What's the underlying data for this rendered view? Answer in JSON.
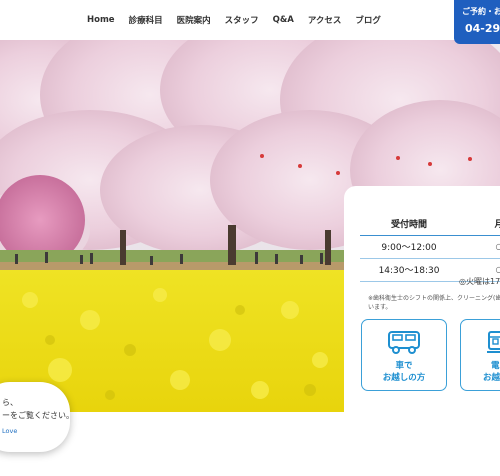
{
  "nav": {
    "items": [
      "Home",
      "診療科目",
      "医院案内",
      "スタッフ",
      "Q&A",
      "アクセス",
      "ブログ"
    ]
  },
  "reserve": {
    "label": "ご予約・お",
    "phone": "04-29",
    "icon": "phone-icon"
  },
  "hours": {
    "header_time": "受付時間",
    "header_day": "月",
    "rows": [
      {
        "time": "9:00〜12:00",
        "mark": "○"
      },
      {
        "time": "14:30〜18:30",
        "mark": "○"
      }
    ],
    "closed": "◎火曜は17",
    "note_line1": "※歯科衛生士のシフトの関係上、クリーニング(歯石の",
    "note_line2": "います。"
  },
  "access": {
    "car_label_1": "車で",
    "car_label_2": "お越しの方",
    "train_label_1": "電",
    "train_label_2": "お越",
    "car_icon": "car-icon",
    "train_icon": "train-icon"
  },
  "chat": {
    "line1": "ら、",
    "line2": "ーをご覧ください。",
    "line3": "Love"
  },
  "colors": {
    "accent": "#1f5fbf",
    "light_blue": "#3ba0d8",
    "rapeseed": "#f2e21c",
    "blossom": "#f1dce6"
  }
}
